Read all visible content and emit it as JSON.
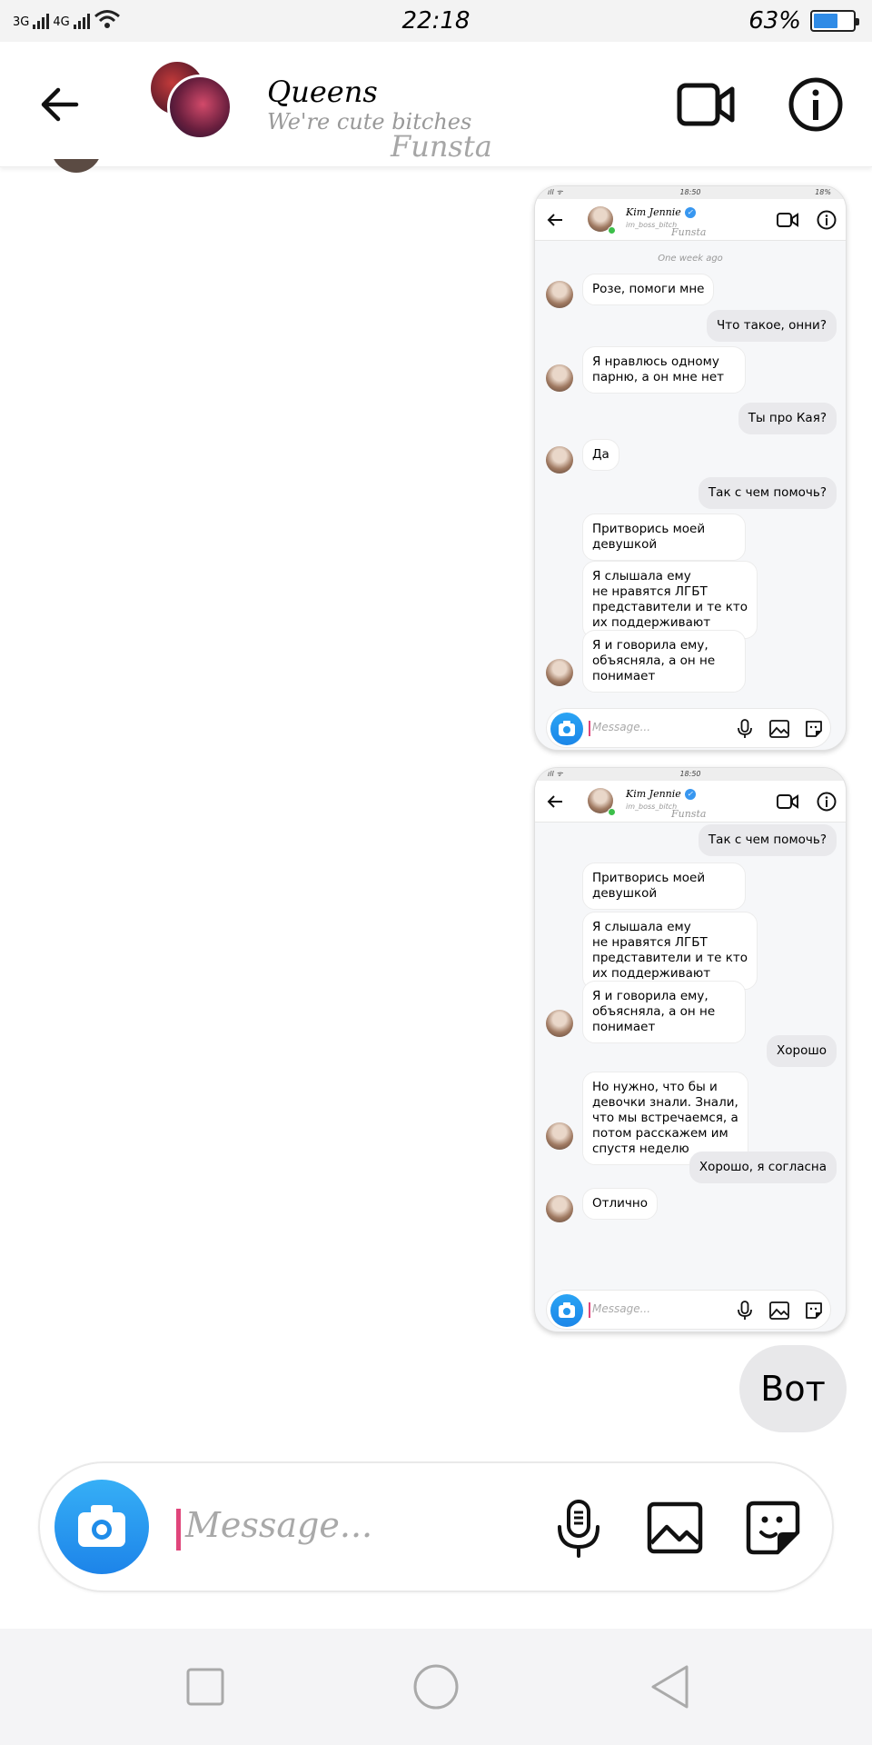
{
  "status_bar": {
    "network1": "3G",
    "network2": "4G",
    "time": "22:18",
    "battery_percent": "63%",
    "battery_level": 0.63
  },
  "header": {
    "title": "Queens",
    "subtitle": "We're cute bitches",
    "watermark": "Funsta"
  },
  "screenshots": [
    {
      "status_time": "18:50",
      "status_battery": "18%",
      "contact_name": "Kim Jennie",
      "contact_username": "im_boss_bitch",
      "watermark": "Funsta",
      "date_divider": "One week ago",
      "messages": [
        {
          "side": "in",
          "text": "Розе, помоги мне"
        },
        {
          "side": "out",
          "text": "Что такое, онни?"
        },
        {
          "side": "in",
          "text": "Я нравлюсь одному\nпарню, а он мне нет"
        },
        {
          "side": "out",
          "text": "Ты про Кая?"
        },
        {
          "side": "in",
          "text": "Да"
        },
        {
          "side": "out",
          "text": "Так с чем помочь?"
        },
        {
          "side": "in",
          "text": "Притворись моей\nдевушкой"
        },
        {
          "side": "in",
          "text": "Я слышала ему\nне нравятся ЛГБТ\nпредставители и те кто\nих поддерживают"
        },
        {
          "side": "in",
          "text": "Я и говорила ему,\nобъясняла, а он не\nпонимает"
        }
      ],
      "placeholder": "Message..."
    },
    {
      "status_time": "18:50",
      "contact_name": "Kim Jennie",
      "contact_username": "im_boss_bitch",
      "watermark": "Funsta",
      "messages": [
        {
          "side": "out",
          "text": "Так с чем помочь?"
        },
        {
          "side": "in",
          "text": "Притворись моей\nдевушкой"
        },
        {
          "side": "in",
          "text": "Я слышала ему\nне нравятся ЛГБТ\nпредставители и те кто\nих поддерживают"
        },
        {
          "side": "in",
          "text": "Я и говорила ему,\nобъясняла, а он не\nпонимает"
        },
        {
          "side": "out",
          "text": "Хорошо"
        },
        {
          "side": "in",
          "text": "Но нужно, что бы и\nдевочки знали. Знали,\nчто мы встречаемся, а\nпотом расскажем им\nспустя неделю"
        },
        {
          "side": "out",
          "text": "Хорошо, я согласна"
        },
        {
          "side": "in",
          "text": "Отлично"
        }
      ],
      "placeholder": "Message..."
    }
  ],
  "last_message": "Вот",
  "composer": {
    "placeholder": "Message..."
  },
  "icons": {
    "back": "arrow-left-icon",
    "video": "video-camera-icon",
    "info": "info-icon",
    "camera": "camera-icon",
    "mic": "microphone-icon",
    "gallery": "image-icon",
    "sticker": "sticker-icon",
    "nav": [
      "square-icon",
      "circle-icon",
      "triangle-back-icon"
    ]
  },
  "colors": {
    "accent_blue": "#1d84e9",
    "cursor_pink": "#e0457b",
    "bubble_out": "#e8e8ea"
  }
}
